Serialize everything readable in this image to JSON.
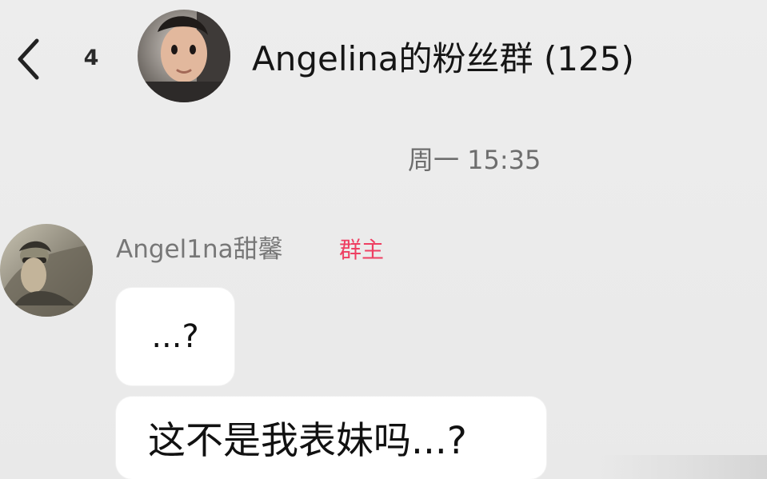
{
  "header": {
    "back_icon": "chevron-left-icon",
    "unread_count": "4",
    "group_title": "Angelina的粉丝群 (125)"
  },
  "conversation": {
    "timestamp": "周一 15:35",
    "messages": [
      {
        "sender": "Angel1na甜馨",
        "role": "群主",
        "bubbles": [
          "...?",
          "这不是我表妹吗...?"
        ]
      }
    ]
  },
  "colors": {
    "background": "#ececec",
    "title_text": "#151515",
    "timestamp_text": "#6d6d6d",
    "sender_name_text": "#777777",
    "role_badge": "#ee3f62",
    "bubble_background": "#ffffff"
  },
  "icons": [
    "chevron-left-icon",
    "group-avatar",
    "sender-avatar"
  ]
}
